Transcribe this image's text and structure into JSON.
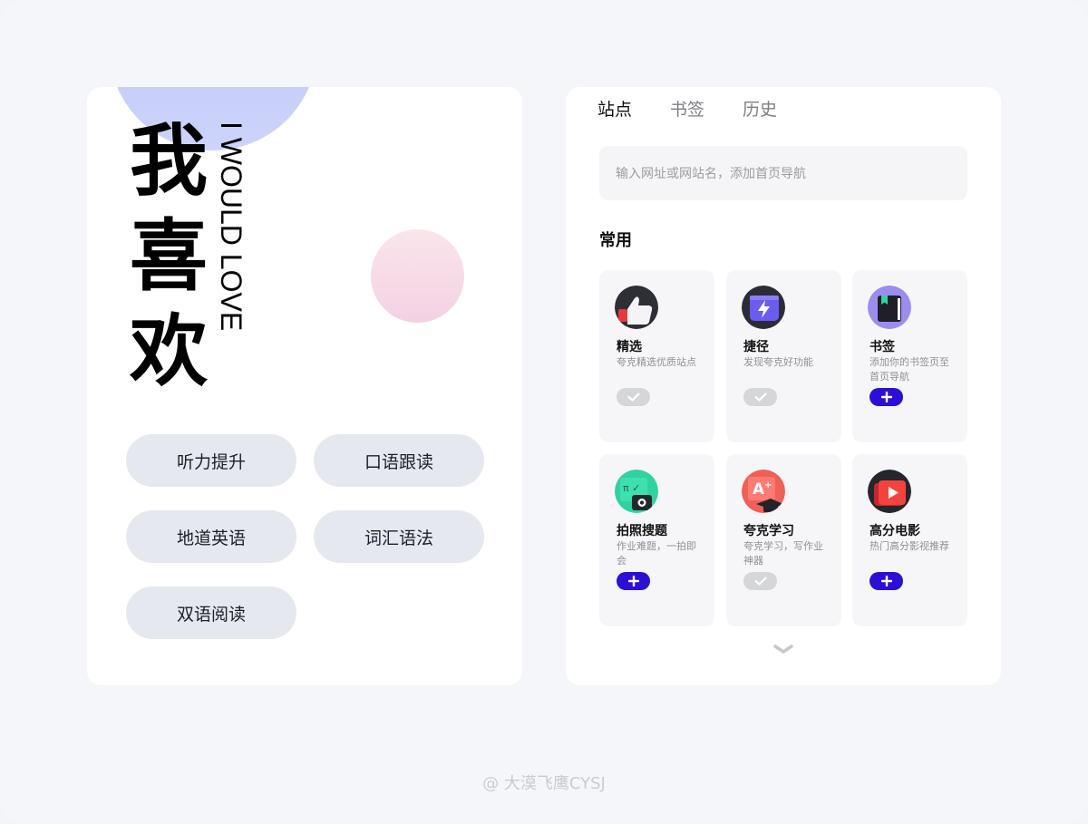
{
  "left": {
    "title_chars": [
      "我",
      "喜",
      "欢"
    ],
    "subtitle": "I WOULD LOVE",
    "pills": [
      "听力提升",
      "口语跟读",
      "地道英语",
      "词汇语法",
      "双语阅读"
    ]
  },
  "right": {
    "tabs": [
      "站点",
      "书签",
      "历史"
    ],
    "active_tab": "站点",
    "search_placeholder": "输入网址或网站名，添加首页导航",
    "section_title": "常用",
    "tiles": [
      {
        "name": "精选",
        "desc": "夸克精选优质站点",
        "state": "added",
        "icon": "thumbs-up-icon"
      },
      {
        "name": "捷径",
        "desc": "发现夸克好功能",
        "state": "added",
        "icon": "lightning-icon"
      },
      {
        "name": "书签",
        "desc": "添加你的书签页至首页导航",
        "state": "add",
        "icon": "bookmark-icon"
      },
      {
        "name": "拍照搜题",
        "desc": "作业难题，一拍即会",
        "state": "add",
        "icon": "camera-icon"
      },
      {
        "name": "夸克学习",
        "desc": "夸克学习，写作业神器",
        "state": "added",
        "icon": "study-icon"
      },
      {
        "name": "高分电影",
        "desc": "热门高分影视推荐",
        "state": "add",
        "icon": "play-icon"
      }
    ],
    "accent_color": "#2b0fd9"
  },
  "watermark": "@ 大漠飞鹰CYSJ"
}
